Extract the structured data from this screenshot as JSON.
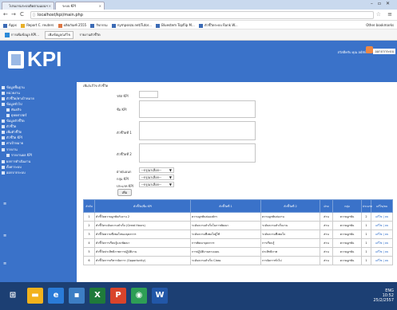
{
  "browser": {
    "tabs": [
      {
        "label": "โปรแกรมระบบติดตามแผนฯ"
      },
      {
        "label": "ระบบ KPI"
      }
    ],
    "url": "localhost/kpi/main.php",
    "bookmarks": [
      {
        "label": "Apps"
      },
      {
        "label": "Report C. reuters"
      },
      {
        "label": "ผลิตภัณฑ์ 2555"
      },
      {
        "label": "กิจกรรม"
      },
      {
        "label": "nympsezo.net/Tutor..."
      },
      {
        "label": "Bluestem Topflip M..."
      },
      {
        "label": "ตัวชี้วัดระบบ Runk W..."
      }
    ],
    "bookmarks_other": "Other bookmarks"
  },
  "app_tabs": [
    {
      "label": "การเพิ่มข้อมูล KPI..."
    },
    {
      "label": "เพิ่มข้อมูล/แก้ไข"
    },
    {
      "label": "รายงานตัวชี้วัด"
    }
  ],
  "header": {
    "logo_text": "KPI",
    "user_label": "สวัสดีครับ คุณ admin",
    "logout_label": "ออกจากระบบ"
  },
  "sidebar": {
    "items": [
      {
        "label": "ข้อมูลพื้นฐาน"
      },
      {
        "label": "หน่วยงาน"
      },
      {
        "label": "ตัวชี้วัด/ค่าเป้าหมาย"
      },
      {
        "label": "ข้อมูลทั่วไป"
      },
      {
        "label": "พันธกิจ"
      },
      {
        "label": "ยุทธศาสตร์"
      },
      {
        "label": "ข้อมูลตัวชี้วัด"
      },
      {
        "label": "ตัวชี้วัด"
      },
      {
        "label": "เพิ่มตัวชี้วัด"
      },
      {
        "label": "ตัวชี้วัด KPI"
      },
      {
        "label": "ค่าเป้าหมาย"
      },
      {
        "label": "รายงาน"
      },
      {
        "label": "รายงานผล KPI"
      },
      {
        "label": "ผลการดำเนินงาน"
      },
      {
        "label": "ตั้งค่าระบบ"
      },
      {
        "label": "ออกจากระบบ"
      }
    ]
  },
  "form": {
    "breadcrumb": "เพิ่ม/แก้ไข ตัวชี้วัด",
    "fields": {
      "kpi_code": "รหัส KPI",
      "kpi_name": "ชื่อ KPI",
      "index1": "ตัวชี้วัดที่ 1",
      "index2": "ตัวชี้วัดที่ 2",
      "division": "ฝ่าย/แผนก",
      "group": "กลุ่ม KPI",
      "type": "ประเภท KPI"
    },
    "select_placeholder": "--กรุณาเลือก--",
    "add_button": "เพิ่ม"
  },
  "table": {
    "headers": [
      "ลำดับ",
      "ตัวชี้วัด/ชื่อ KPI",
      "ตัวชี้วัดที่ 1",
      "ตัวชี้วัดที่ 2",
      "ฝ่าย",
      "กลุ่ม",
      "ประเภท",
      "แก้ไข/ลบ"
    ],
    "rows": [
      [
        "1",
        "ตัวชี้วัดความผูกพันกับงาน 2",
        "ความผูกพันต่อองค์กร",
        "ความผูกพันต่องาน",
        "ส่วน",
        "ความผูกพัน",
        "2",
        "แก้ไข | ลบ"
      ],
      [
        "2",
        "ตัวชี้วัดระดับความสำเร็จ (Great Hours)",
        "ระดับความสำเร็จในการพัฒนา",
        "ระดับความสำเร็จงาน",
        "ส่วน",
        "ความผูกพัน",
        "1",
        "แก้ไข | ลบ"
      ],
      [
        "3",
        "ตัวชี้วัดความพึงพอใจของบุคลากร",
        "ระดับความพึงพอใจผู้ใช้",
        "ระดับความพึงพอใจ",
        "ส่วน",
        "ความผูกพัน",
        "1",
        "แก้ไข | ลบ"
      ],
      [
        "4",
        "ตัวชี้วัดการเรียนรู้และพัฒนา",
        "การพัฒนาบุคลากร",
        "การเรียนรู้",
        "ส่วน",
        "ความผูกพัน",
        "1",
        "แก้ไข | ลบ"
      ],
      [
        "5",
        "ตัวชี้วัดประสิทธิภาพการปฏิบัติงาน",
        "การปฏิบัติงานตามแผน",
        "ประสิทธิภาพ",
        "ส่วน",
        "ความผูกพัน",
        "1",
        "แก้ไข | ลบ"
      ],
      [
        "6",
        "ตัวชี้วัดการบริหารจัดการ (Opportunity)",
        "ระดับความสำเร็จ Class",
        "การจัดการทั่วไป",
        "ส่วน",
        "ความผูกพัน",
        "1",
        "แก้ไข | ลบ"
      ]
    ]
  },
  "taskbar": {
    "time": "10:52",
    "date": "25/2/2557",
    "lang": "ENG"
  }
}
